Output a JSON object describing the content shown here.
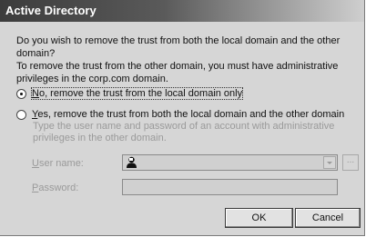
{
  "window": {
    "title": "Active Directory"
  },
  "message": {
    "line1": "Do you wish to remove the trust from both the local domain and the other domain?",
    "line2": "To remove the trust from the other domain, you must have administrative privileges in the corp.com domain."
  },
  "options": [
    {
      "prefix": "N",
      "rest": "o, remove the trust from the local domain only",
      "selected": true
    },
    {
      "prefix": "Y",
      "rest": "es, remove the trust from both the local domain and the other domain",
      "selected": false
    }
  ],
  "credentials": {
    "hint": "Type the user name and password of an account with administrative privileges in the other domain.",
    "username_prefix": "U",
    "username_rest": "ser name:",
    "username_value": "",
    "password_prefix": "P",
    "password_rest": "assword:",
    "password_value": "",
    "browse_label": "..."
  },
  "buttons": {
    "ok": "OK",
    "cancel": "Cancel"
  },
  "icons": {
    "user_picker": "user-icon",
    "dropdown": "chevron-down-icon"
  }
}
